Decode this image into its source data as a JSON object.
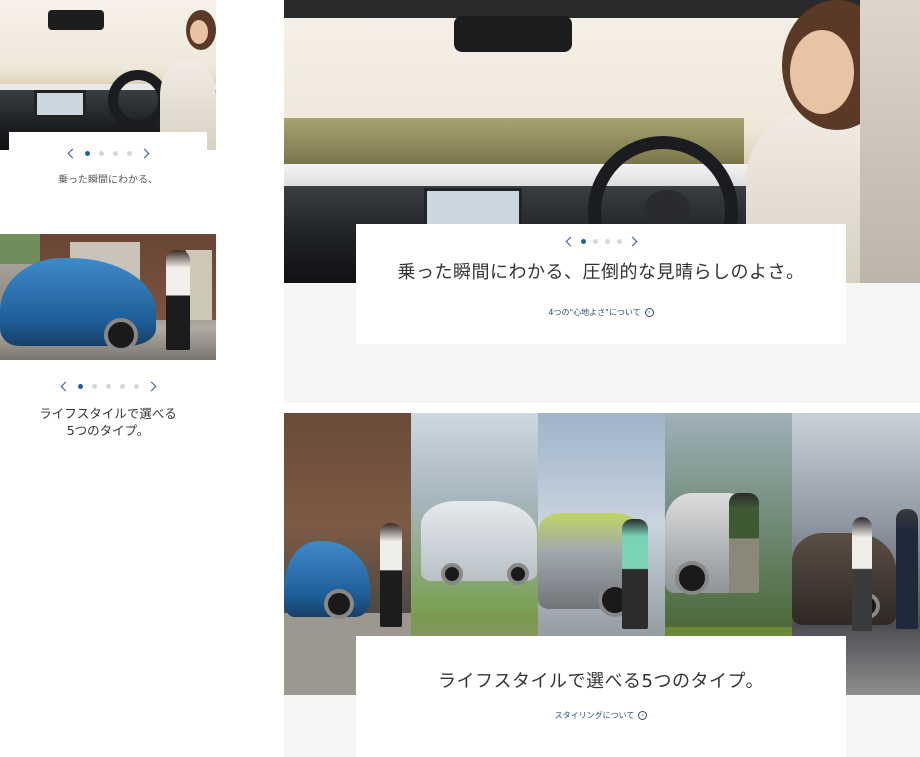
{
  "thumbnails": {
    "first": {
      "caption": "乗った瞬間にわかる、",
      "dots_total": 5,
      "active_dot": 1
    },
    "second": {
      "caption_line1": "ライフスタイルで選べる",
      "caption_line2": "5つのタイプ。",
      "dots_total": 5,
      "active_dot": 1
    }
  },
  "main": {
    "slide1": {
      "headline": "乗った瞬間にわかる、圧倒的な見晴らしのよさ。",
      "link_label": "4つの\"心地よさ\"について",
      "dots_total": 4,
      "active_dot": 1
    },
    "slide2": {
      "headline": "ライフスタイルで選べる5つのタイプ。",
      "link_label": "スタイリングについて"
    }
  },
  "icons": {
    "prev": "chevron-left-icon",
    "next": "chevron-right-icon",
    "link_arrow": "circle-arrow-right-icon"
  },
  "colors": {
    "accent": "#1f5fa6",
    "link": "#2c4c7a",
    "dot_inactive": "#d7d7d7",
    "panel_bg": "#f5f5f5"
  }
}
